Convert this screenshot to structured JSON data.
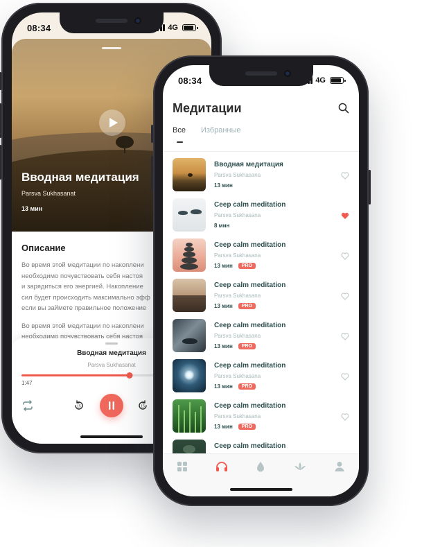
{
  "status": {
    "time": "08:34",
    "network": "4G"
  },
  "player_screen": {
    "track_title": "Вводная медитация",
    "author": "Parsva Sukhasanat",
    "duration": "13 мин",
    "description_heading": "Описание",
    "description_lines": [
      "Во время этой медитации по накоплени",
      "необходимо почувствовать себя настоя",
      "и зарядиться его энергией. Накопление",
      "сил будет происходить максимально эфф",
      "если вы займете правильное положение"
    ],
    "description_lines_2": [
      "Во время этой медитации по накоплени",
      "необходимо почувствовать себя настоя"
    ],
    "mini_player": {
      "title": "Вводная медитация",
      "author": "Parsva Sukhasanat",
      "elapsed": "1:47",
      "progress_fraction": 0.6
    }
  },
  "list_screen": {
    "title": "Медитации",
    "tabs": [
      {
        "label": "Все",
        "active": true
      },
      {
        "label": "Избранные",
        "active": false
      }
    ],
    "items": [
      {
        "name": "Вводная медитация",
        "author": "Parsva Sukhasana",
        "duration": "13 мин",
        "pro": false,
        "favorite": false
      },
      {
        "name": "Ceep calm meditation",
        "author": "Parsva Sukhasana",
        "duration": "8 мин",
        "pro": false,
        "favorite": true
      },
      {
        "name": "Ceep calm meditation",
        "author": "Parsva Sukhasana",
        "duration": "13 мин",
        "pro": true,
        "favorite": false
      },
      {
        "name": "Ceep calm meditation",
        "author": "Parsva Sukhasana",
        "duration": "13 мин",
        "pro": true,
        "favorite": false
      },
      {
        "name": "Ceep calm meditation",
        "author": "Parsva Sukhasana",
        "duration": "13 мин",
        "pro": true,
        "favorite": false
      },
      {
        "name": "Ceep calm meditation",
        "author": "Parsva Sukhasana",
        "duration": "13 мин",
        "pro": true,
        "favorite": false
      },
      {
        "name": "Ceep calm meditation",
        "author": "Parsva Sukhasana",
        "duration": "13 мин",
        "pro": true,
        "favorite": false
      },
      {
        "name": "Ceep calm meditation",
        "author": "",
        "duration": "",
        "pro": false,
        "favorite": false
      }
    ],
    "pro_label": "PRO",
    "tabbar": [
      "grid-icon",
      "headphones-icon",
      "drop-icon",
      "lotus-icon",
      "profile-icon"
    ],
    "active_tab_index": 1
  },
  "colors": {
    "accent": "#f05a4f",
    "title_text": "#2f4f4f",
    "muted_text": "#a7b9ba"
  }
}
